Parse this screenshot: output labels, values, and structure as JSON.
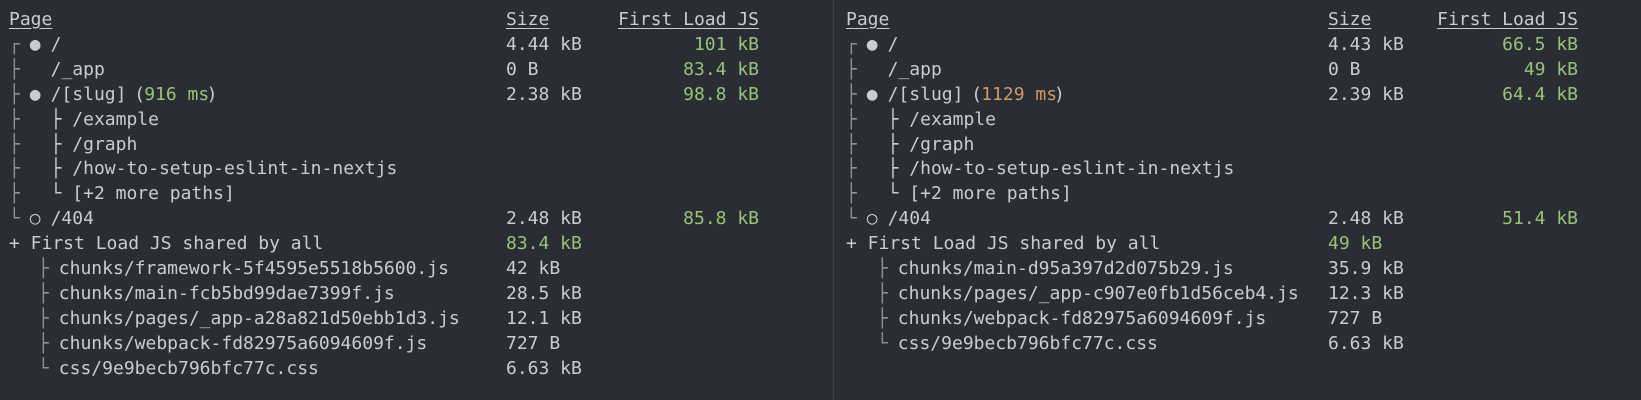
{
  "left": {
    "headers": {
      "page": "Page",
      "size": "Size",
      "first_load_js": "First Load JS"
    },
    "routes": [
      {
        "tree": "┌",
        "sym": "●",
        "name": "/",
        "timing_open": "",
        "timing": "",
        "timing_close": "",
        "size": "4.44 kB",
        "first_load": "101 kB"
      },
      {
        "tree": "├",
        "sym": " ",
        "name": "/_app",
        "timing_open": "",
        "timing": "",
        "timing_close": "",
        "size": "0 B",
        "first_load": "83.4 kB"
      },
      {
        "tree": "├",
        "sym": "●",
        "name": "/[slug]",
        "timing_open": " (",
        "timing": "916 ms",
        "timing_close": ")",
        "size": "2.38 kB",
        "first_load": "98.8 kB"
      },
      {
        "tree": "├",
        "sym": "",
        "name": "├ /example",
        "timing_open": "",
        "timing": "",
        "timing_close": "",
        "size": "",
        "first_load": ""
      },
      {
        "tree": "├",
        "sym": "",
        "name": "├ /graph",
        "timing_open": "",
        "timing": "",
        "timing_close": "",
        "size": "",
        "first_load": ""
      },
      {
        "tree": "├",
        "sym": "",
        "name": "├ /how-to-setup-eslint-in-nextjs",
        "timing_open": "",
        "timing": "",
        "timing_close": "",
        "size": "",
        "first_load": ""
      },
      {
        "tree": "├",
        "sym": "",
        "name": "└ [+2 more paths]",
        "timing_open": "",
        "timing": "",
        "timing_close": "",
        "size": "",
        "first_load": ""
      },
      {
        "tree": "└",
        "sym": "○",
        "name": "/404",
        "timing_open": "",
        "timing": "",
        "timing_close": "",
        "size": "2.48 kB",
        "first_load": "85.8 kB"
      }
    ],
    "shared": {
      "label": "+ First Load JS shared by all",
      "size": "83.4 kB"
    },
    "chunks": [
      {
        "tree": "├",
        "name": "chunks/framework-5f4595e5518b5600.js",
        "size": "42 kB"
      },
      {
        "tree": "├",
        "name": "chunks/main-fcb5bd99dae7399f.js",
        "size": "28.5 kB"
      },
      {
        "tree": "├",
        "name": "chunks/pages/_app-a28a821d50ebb1d3.js",
        "size": "12.1 kB"
      },
      {
        "tree": "├",
        "name": "chunks/webpack-fd82975a6094609f.js",
        "size": "727 B"
      },
      {
        "tree": "└",
        "name": "css/9e9becb796bfc77c.css",
        "size": "6.63 kB"
      }
    ]
  },
  "right": {
    "headers": {
      "page": "Page",
      "size": "Size",
      "first_load_js": "First Load JS"
    },
    "routes": [
      {
        "tree": "┌",
        "sym": "●",
        "name": "/",
        "timing_open": "",
        "timing": "",
        "timing_close": "",
        "size": "4.43 kB",
        "first_load": "66.5 kB"
      },
      {
        "tree": "├",
        "sym": " ",
        "name": "/_app",
        "timing_open": "",
        "timing": "",
        "timing_close": "",
        "size": "0 B",
        "first_load": "49 kB"
      },
      {
        "tree": "├",
        "sym": "●",
        "name": "/[slug]",
        "timing_open": " (",
        "timing": "1129 ms",
        "timing_close": ")",
        "size": "2.39 kB",
        "first_load": "64.4 kB"
      },
      {
        "tree": "├",
        "sym": "",
        "name": "├ /example",
        "timing_open": "",
        "timing": "",
        "timing_close": "",
        "size": "",
        "first_load": ""
      },
      {
        "tree": "├",
        "sym": "",
        "name": "├ /graph",
        "timing_open": "",
        "timing": "",
        "timing_close": "",
        "size": "",
        "first_load": ""
      },
      {
        "tree": "├",
        "sym": "",
        "name": "├ /how-to-setup-eslint-in-nextjs",
        "timing_open": "",
        "timing": "",
        "timing_close": "",
        "size": "",
        "first_load": ""
      },
      {
        "tree": "├",
        "sym": "",
        "name": "└ [+2 more paths]",
        "timing_open": "",
        "timing": "",
        "timing_close": "",
        "size": "",
        "first_load": ""
      },
      {
        "tree": "└",
        "sym": "○",
        "name": "/404",
        "timing_open": "",
        "timing": "",
        "timing_close": "",
        "size": "2.48 kB",
        "first_load": "51.4 kB"
      }
    ],
    "shared": {
      "label": "+ First Load JS shared by all",
      "size": "49 kB"
    },
    "chunks": [
      {
        "tree": "├",
        "name": "chunks/main-d95a397d2d075b29.js",
        "size": "35.9 kB"
      },
      {
        "tree": "├",
        "name": "chunks/pages/_app-c907e0fb1d56ceb4.js",
        "size": "12.3 kB"
      },
      {
        "tree": "├",
        "name": "chunks/webpack-fd82975a6094609f.js",
        "size": "727 B"
      },
      {
        "tree": "└",
        "name": "css/9e9becb796bfc77c.css",
        "size": "6.63 kB"
      }
    ]
  },
  "colors": {
    "background": "#2a2d33",
    "text": "#c8ccd4",
    "green": "#98c379",
    "orange": "#d19a66"
  }
}
